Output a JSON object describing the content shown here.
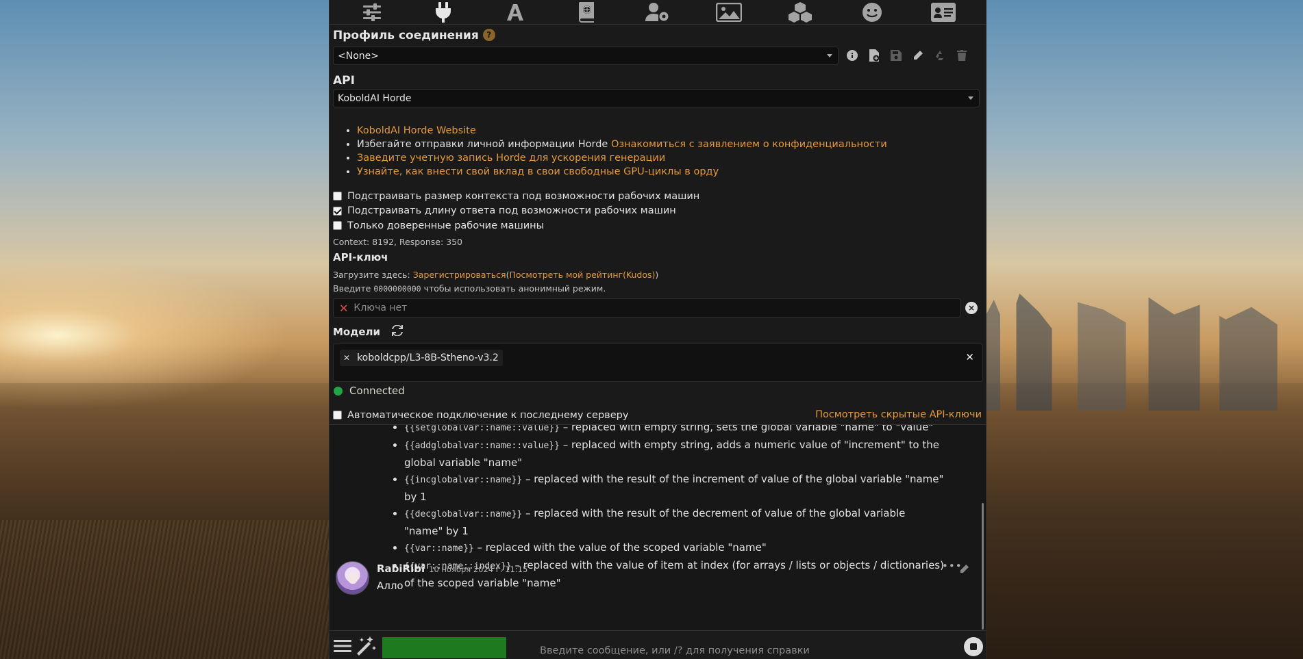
{
  "topnav": {
    "icons": [
      "sliders-icon",
      "plug-icon",
      "font-icon",
      "book-globe-icon",
      "user-gear-icon",
      "image-icon",
      "cubes-icon",
      "smile-icon",
      "id-card-icon"
    ],
    "active": "plug-icon"
  },
  "connection_profile": {
    "title": "Профиль соединения",
    "help": "?",
    "selected": "<None>"
  },
  "api": {
    "label": "API",
    "selected": "KoboldAI Horde",
    "links": {
      "website": "KoboldAI Horde Website",
      "avoid_text": "Избегайте отправки личной информации Horde",
      "privacy_link": "Ознакомиться с заявлением о конфиденциальности",
      "register_link": "Заведите учетную запись Horde для ускорения генерации",
      "contribute_link": "Узнайте, как внести свой вклад в свои свободные GPU-циклы в орду"
    },
    "checkboxes": [
      {
        "label": "Подстраивать размер контекста под возможности рабочих машин",
        "checked": false
      },
      {
        "label": "Подстраивать длину ответа под возможности рабочих машин",
        "checked": true
      },
      {
        "label": "Только доверенные рабочие машины",
        "checked": false
      }
    ],
    "context_info": "Context: 8192, Response: 350"
  },
  "api_key": {
    "title": "API-ключ",
    "load_here": "Загрузите здесь:",
    "register": "Зарегистрироваться",
    "kudos": "Посмотреть мой рейтинг(Kudos)",
    "enter_prefix": "Введите",
    "anon_code": "0000000000",
    "enter_suffix": "чтобы использовать анонимный режим.",
    "placeholder": "Ключа нет"
  },
  "models": {
    "title": "Модели",
    "chip": "koboldcpp/L3-8B-Stheno-v3.2"
  },
  "status": {
    "connected": "Connected",
    "status_color": "#21a645",
    "auto_connect": "Автоматическое подключение к последнему серверу",
    "hidden_keys": "Посмотреть скрытые API-ключи"
  },
  "chat": {
    "macros": [
      {
        "code": "{{setglobalvar::name::value}}",
        "text": " – replaced with empty string, sets the global variable \"name\" to \"value\""
      },
      {
        "code": "{{addglobalvar::name::value}}",
        "text": " – replaced with empty string, adds a numeric value of \"increment\" to the global variable \"name\""
      },
      {
        "code": "{{incglobalvar::name}}",
        "text": " – replaced with the result of the increment of value of the global variable \"name\" by 1"
      },
      {
        "code": "{{decglobalvar::name}}",
        "text": " – replaced with the result of the decrement of value of the global variable \"name\" by 1"
      },
      {
        "code": "{{var::name}}",
        "text": " – replaced with the value of the scoped variable \"name\""
      },
      {
        "code": "{{var::name::index}}",
        "text": " – replaced with the value of item at index (for arrays / lists or objects / dictionaries) of the scoped variable \"name\""
      }
    ],
    "message": {
      "author": "RabiRibi",
      "timestamp": "10 ноября 2024 г. 11:15",
      "text": "Алло"
    }
  },
  "input": {
    "placeholder": "Введите сообщение, или /? для получения справки"
  },
  "colors": {
    "accent": "#e49a3d",
    "panel": "#171717",
    "green_block": "#1e7a1f"
  }
}
